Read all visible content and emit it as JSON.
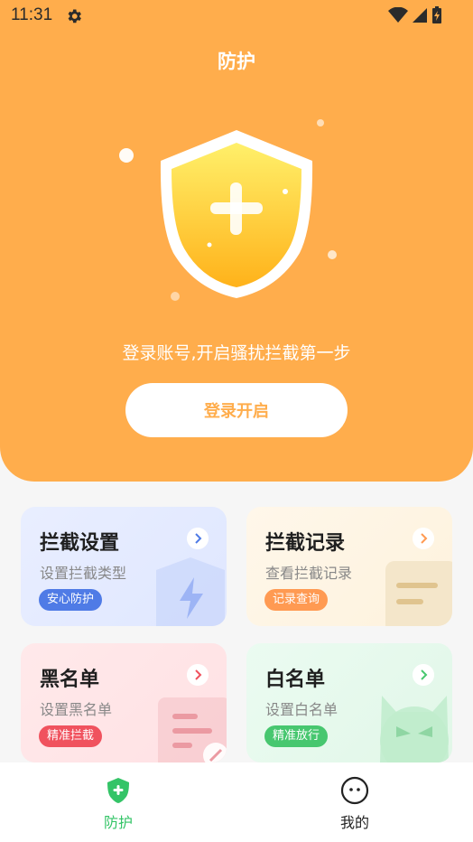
{
  "status_bar": {
    "time": "11:31"
  },
  "hero": {
    "title": "防护",
    "description": "登录账号,开启骚扰拦截第一步",
    "login_button": "登录开启"
  },
  "cards": [
    {
      "title": "拦截设置",
      "subtitle": "设置拦截类型",
      "tag": "安心防护",
      "tag_color": "#4f7be6",
      "arrow_color": "#4f7be6"
    },
    {
      "title": "拦截记录",
      "subtitle": "查看拦截记录",
      "tag": "记录查询",
      "tag_color": "#ff9a52",
      "arrow_color": "#ff9a52"
    },
    {
      "title": "黑名单",
      "subtitle": "设置黑名单",
      "tag": "精准拦截",
      "tag_color": "#f0525e",
      "arrow_color": "#f0525e"
    },
    {
      "title": "白名单",
      "subtitle": "设置白名单",
      "tag": "精准放行",
      "tag_color": "#47c76f",
      "arrow_color": "#47c76f"
    }
  ],
  "tabbar": [
    {
      "label": "防护",
      "icon": "shield-plus-icon",
      "active": true,
      "color": "#34c467"
    },
    {
      "label": "我的",
      "icon": "smiley-face-icon",
      "active": false,
      "color": "#222222"
    }
  ],
  "colors": {
    "accent": "#ffad4c",
    "active_tab": "#34c467"
  }
}
